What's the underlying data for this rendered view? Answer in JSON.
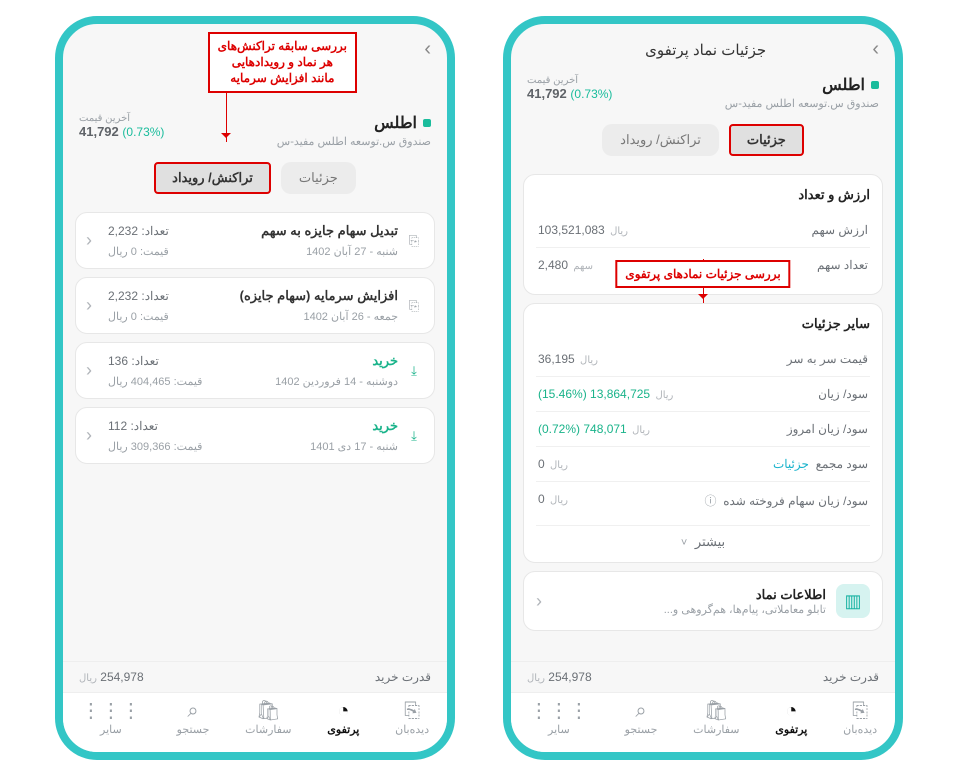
{
  "rightPhone": {
    "header_title": "جزئیات نماد پرتفوی",
    "annotation": "بررسی جزئیات\nنمادهای پرتفوی",
    "symbol": {
      "name": "اطلس",
      "desc": "صندوق س.توسعه اطلس مفید-س"
    },
    "price": {
      "label": "آخرین قیمت",
      "value": "41,792",
      "pct": "(0.73%)"
    },
    "tabs": {
      "details": "جزئیات",
      "events": "تراکنش/ رویداد"
    },
    "valueCount": {
      "title": "ارزش و تعداد",
      "rows": [
        {
          "k": "ارزش سهم",
          "v": "103,521,083",
          "u": "ریال"
        },
        {
          "k": "تعداد سهم",
          "v": "2,480",
          "u": "سهم"
        }
      ]
    },
    "otherDetails": {
      "title": "سایر جزئیات",
      "rows": [
        {
          "k": "قیمت سر به سر",
          "v": "36,195",
          "u": "ریال",
          "cls": ""
        },
        {
          "k": "سود/ زیان",
          "v": "(15.46%) 13,864,725",
          "u": "ریال",
          "cls": "green"
        },
        {
          "k": "سود/ زیان امروز",
          "v": "(0.72%) 748,071",
          "u": "ریال",
          "cls": "green"
        },
        {
          "k": "سود مجمع",
          "v": "0",
          "u": "ریال",
          "cls": "",
          "link": "جزئیات"
        },
        {
          "k": "سود/ زیان سهام فروخته شده",
          "v": "0",
          "u": "ریال",
          "cls": "",
          "help": true
        }
      ],
      "more": "بیشتر"
    },
    "infoCard": {
      "title": "اطلاعات نماد",
      "sub": "تابلو معاملاتی، پیام‌ها، هم‌گروهی و..."
    }
  },
  "leftPhone": {
    "annotation": "بررسی سابقه تراکنش‌های\nهر نماد و رویدادهایی\nمانند افزایش سرمایه",
    "symbol": {
      "name": "اطلس",
      "desc": "صندوق س.توسعه اطلس مفید-س"
    },
    "price": {
      "label": "آخرین قیمت",
      "value": "41,792",
      "pct": "(0.73%)"
    },
    "tabs": {
      "details": "جزئیات",
      "events": "تراکنش/ رویداد"
    },
    "txns": [
      {
        "title": "تبدیل سهام جایزه به سهم",
        "date": "شنبه - 27 آبان 1402",
        "count": "تعداد: 2,232",
        "price": "قیمت: 0 ریال",
        "cls": ""
      },
      {
        "title": "افزایش سرمایه (سهام جایزه)",
        "date": "جمعه - 26 آبان 1402",
        "count": "تعداد: 2,232",
        "price": "قیمت: 0 ریال",
        "cls": ""
      },
      {
        "title": "خرید",
        "date": "دوشنبه - 14 فروردین 1402",
        "count": "تعداد: 136",
        "price": "قیمت: 404,465 ریال",
        "cls": "green"
      },
      {
        "title": "خرید",
        "date": "شنبه - 17 دی 1401",
        "count": "تعداد: 112",
        "price": "قیمت: 309,366 ریال",
        "cls": "green"
      }
    ]
  },
  "bp": {
    "label": "قدرت خرید",
    "value": "254,978",
    "u": "ریال"
  },
  "nav": {
    "items": [
      {
        "id": "watch",
        "label": "دیده‌بان",
        "icon": "⎘"
      },
      {
        "id": "portfolio",
        "label": "پرتفوی",
        "icon": "◔"
      },
      {
        "id": "orders",
        "label": "سفارشات",
        "icon": "🛍"
      },
      {
        "id": "search",
        "label": "جستجو",
        "icon": "⌕"
      },
      {
        "id": "more",
        "label": "سایر",
        "icon": "⋮⋮⋮"
      }
    ]
  }
}
